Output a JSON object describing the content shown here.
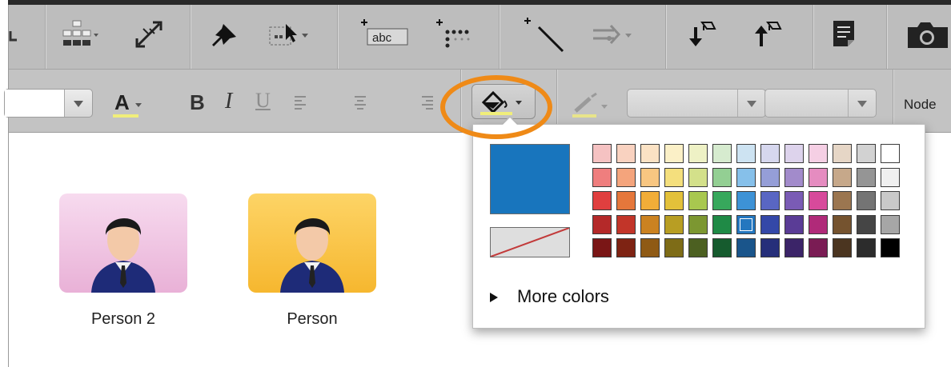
{
  "toolbar_top": {
    "icons": [
      "layout-icon",
      "hierarchy-layout-icon",
      "expand-icon",
      "pin-icon",
      "select-area-icon",
      "add-text-icon",
      "add-node-icon",
      "add-link-icon",
      "arrow-style-icon",
      "move-down-icon",
      "move-up-icon",
      "notes-icon",
      "camera-icon"
    ],
    "text_icon_label": "abc"
  },
  "toolbar_format": {
    "font_color_letter": "A",
    "bold_label": "B",
    "italic_label": "I",
    "underline_label": "U",
    "nodes_label": "Node",
    "highlight_underline_color": "#f0ee7a"
  },
  "canvas": {
    "persons": [
      {
        "label": "Person 2",
        "bg_color": "#efc3e2"
      },
      {
        "label": "Person",
        "bg_color": "#fcc646"
      }
    ]
  },
  "color_popup": {
    "current_color": "#1875bd",
    "more_colors_label": "More colors",
    "selected_cell": "r3-c6",
    "rows": [
      [
        "#f5c2c2",
        "#f9d2c0",
        "#fbe2c4",
        "#fbf0c7",
        "#eef1c5",
        "#d6ebcf",
        "#cde3f2",
        "#d6d7ee",
        "#ddd3ec",
        "#f5cfe4",
        "#e6d6c6",
        "#d2d2d2",
        "#ffffff"
      ],
      [
        "#ef7e7e",
        "#f4a47c",
        "#f8c681",
        "#f4df7d",
        "#d3e08a",
        "#93cf93",
        "#86c0ea",
        "#959ed7",
        "#a28bcb",
        "#e58cc0",
        "#c6a88a",
        "#959595",
        "#f0f0f0"
      ],
      [
        "#e03f3f",
        "#e5773b",
        "#f1ad38",
        "#e3c13a",
        "#a8c74f",
        "#37a85c",
        "#3d92d6",
        "#5966c3",
        "#7a5bb5",
        "#d74a9b",
        "#9b7650",
        "#747474",
        "#c9c9c9"
      ],
      [
        "#b42929",
        "#c23529",
        "#cb8221",
        "#b89e23",
        "#7c9731",
        "#1f8a46",
        "#2477bf",
        "#3448a8",
        "#5a3c96",
        "#b02a79",
        "#75532f",
        "#454545",
        "#a6a6a6"
      ],
      [
        "#7a1616",
        "#7e2313",
        "#8f5a15",
        "#7e6c17",
        "#4c6021",
        "#165b2e",
        "#1a558b",
        "#262f7a",
        "#3b2468",
        "#7a1c54",
        "#4b3520",
        "#2c2c2c",
        "#000000"
      ]
    ]
  },
  "highlight": {
    "ring_color": "#ef8a17"
  }
}
